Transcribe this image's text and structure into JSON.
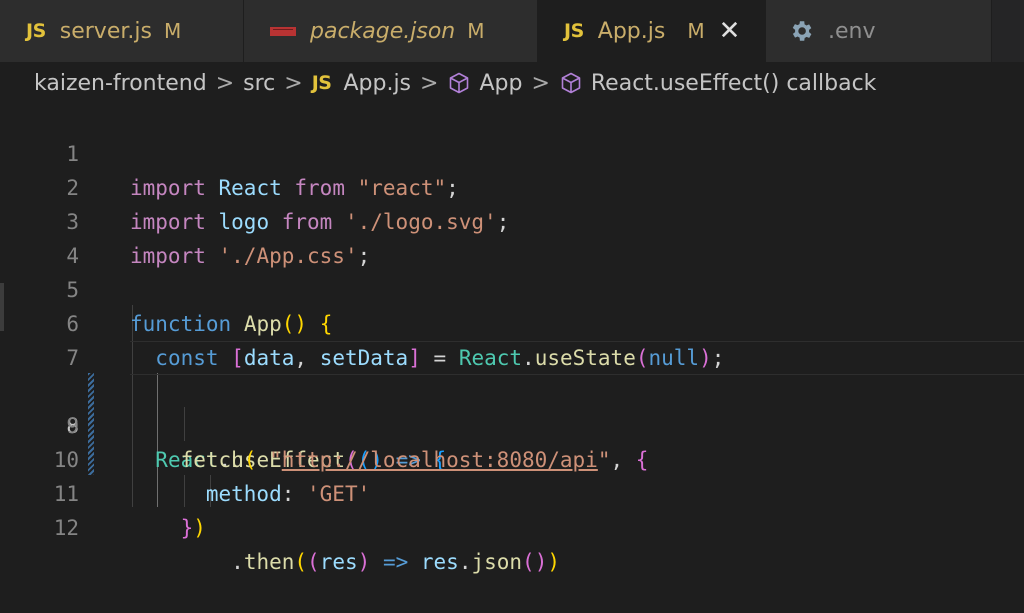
{
  "tabs": [
    {
      "icon": "js-icon",
      "icon_text": "JS",
      "label": "server.js",
      "modified": "M"
    },
    {
      "icon": "npm-icon",
      "icon_text": "",
      "label": "package.json",
      "modified": "M"
    },
    {
      "icon": "js-icon",
      "icon_text": "JS",
      "label": "App.js",
      "modified": "M",
      "close": "✕"
    },
    {
      "icon": "gear-icon",
      "icon_text": "",
      "label": ".env",
      "modified": ""
    }
  ],
  "breadcrumb": {
    "project": "kaizen-frontend",
    "folder": "src",
    "file_icon": "JS",
    "file": "App.js",
    "symbol": "App",
    "callback": "React.useEffect() callback",
    "separator": ">"
  },
  "code": {
    "line_numbers": [
      "1",
      "2",
      "3",
      "4",
      "5",
      "6",
      "7",
      "8",
      "9",
      "10",
      "11",
      "12"
    ],
    "line1": {
      "a": "import",
      "b": "React",
      "c": "from",
      "d": "\"react\"",
      "e": ";"
    },
    "line2": {
      "a": "import",
      "b": "logo",
      "c": "from",
      "d": "'./logo.svg'",
      "e": ";"
    },
    "line3": {
      "a": "import",
      "d": "'./App.css'",
      "e": ";"
    },
    "line5": {
      "a": "function",
      "b": "App",
      "c": "()",
      "d": "{"
    },
    "line6": {
      "a": "const",
      "b": "[",
      "c": "data",
      "d": ", ",
      "e": "setData",
      "f": "]",
      "g": " = ",
      "h": "React",
      "i": ".",
      "j": "useState",
      "k": "(",
      "l": "null",
      "m": ")",
      "n": ";"
    },
    "line8": {
      "a": "React",
      "b": ".",
      "c": "useEffect",
      "d": "(",
      "e": "()",
      "f": " => ",
      "g": "{"
    },
    "line9": {
      "a": "fetch",
      "b": "(",
      "c": " \"",
      "d": "http://localhost:8080/api",
      "e": "\"",
      "f": ", ",
      "g": "{"
    },
    "line10": {
      "a": "method",
      "b": ": ",
      "c": "'GET'"
    },
    "line11": {
      "a": "}",
      "b": ")"
    },
    "line12": {
      "a": ".",
      "b": "then",
      "c": "(",
      "d": "(",
      "e": "res",
      "f": ")",
      "g": " => ",
      "h": "res",
      "i": ".",
      "j": "json",
      "k": "()",
      "l": ")"
    }
  }
}
